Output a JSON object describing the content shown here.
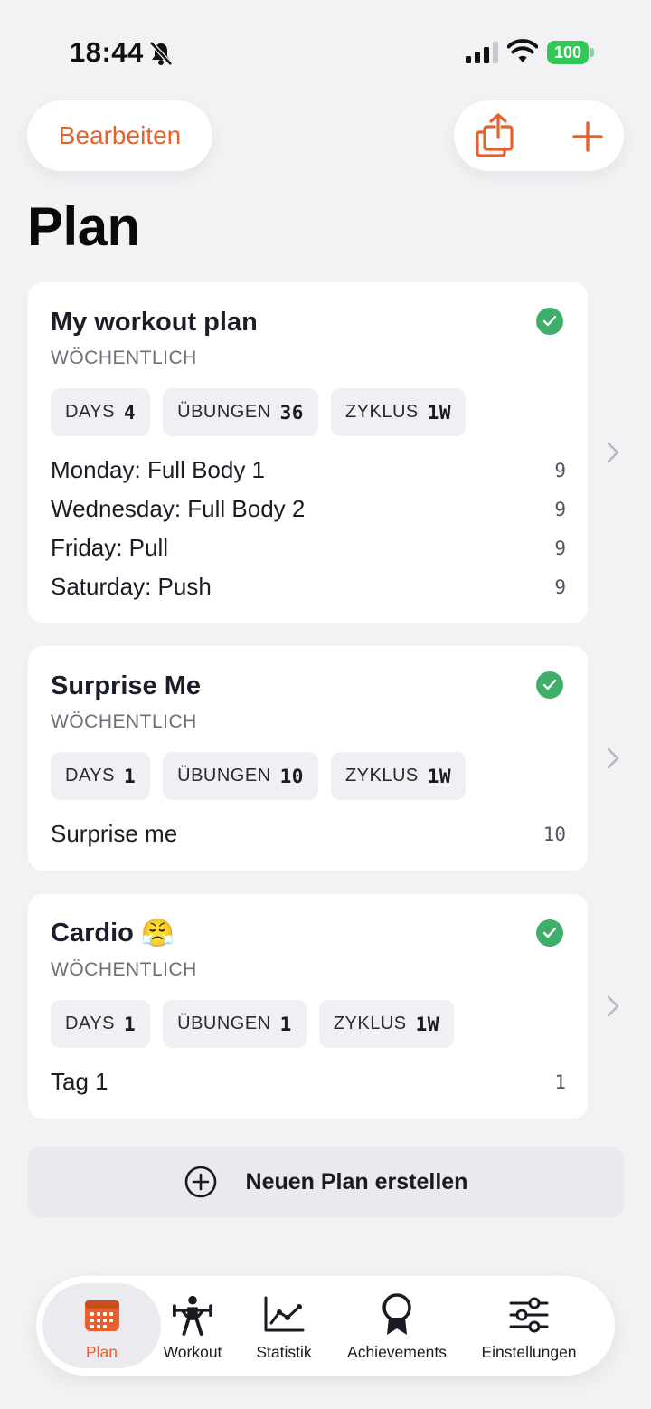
{
  "status": {
    "time": "18:44",
    "battery": "100"
  },
  "header": {
    "edit_label": "Bearbeiten",
    "title": "Plan"
  },
  "icons": {
    "bell": "bell-slash-icon",
    "share": "share-icon",
    "add": "plus-icon",
    "check": "checkmark-circle-icon",
    "chevron": "chevron-right-icon",
    "new_plan": "plus-circle-icon"
  },
  "colors": {
    "accent": "#e8612c",
    "check": "#3fae6a",
    "battery": "#34c759"
  },
  "plans": [
    {
      "title": "My workout plan",
      "emoji": "",
      "frequency": "WÖCHENTLICH",
      "stats": [
        {
          "label": "DAYS",
          "value": "4"
        },
        {
          "label": "ÜBUNGEN",
          "value": "36"
        },
        {
          "label": "ZYKLUS",
          "value": "1W"
        }
      ],
      "days": [
        {
          "label": "Monday: Full Body 1",
          "count": "9"
        },
        {
          "label": "Wednesday: Full Body 2",
          "count": "9"
        },
        {
          "label": "Friday: Pull",
          "count": "9"
        },
        {
          "label": "Saturday: Push",
          "count": "9"
        }
      ]
    },
    {
      "title": "Surprise Me",
      "emoji": "",
      "frequency": "WÖCHENTLICH",
      "stats": [
        {
          "label": "DAYS",
          "value": "1"
        },
        {
          "label": "ÜBUNGEN",
          "value": "10"
        },
        {
          "label": "ZYKLUS",
          "value": "1W"
        }
      ],
      "days": [
        {
          "label": "Surprise me",
          "count": "10"
        }
      ]
    },
    {
      "title": "Cardio",
      "emoji": "😤",
      "frequency": "WÖCHENTLICH",
      "stats": [
        {
          "label": "DAYS",
          "value": "1"
        },
        {
          "label": "ÜBUNGEN",
          "value": "1"
        },
        {
          "label": "ZYKLUS",
          "value": "1W"
        }
      ],
      "days": [
        {
          "label": "Tag 1",
          "count": "1"
        }
      ]
    }
  ],
  "new_plan": {
    "label": "Neuen Plan erstellen"
  },
  "tabs": [
    {
      "label": "Plan",
      "icon": "calendar-icon",
      "active": true
    },
    {
      "label": "Workout",
      "icon": "weightlifter-icon",
      "active": false
    },
    {
      "label": "Statistik",
      "icon": "chart-line-icon",
      "active": false
    },
    {
      "label": "Achievements",
      "icon": "award-ribbon-icon",
      "active": false
    },
    {
      "label": "Einstellungen",
      "icon": "sliders-icon",
      "active": false
    }
  ]
}
